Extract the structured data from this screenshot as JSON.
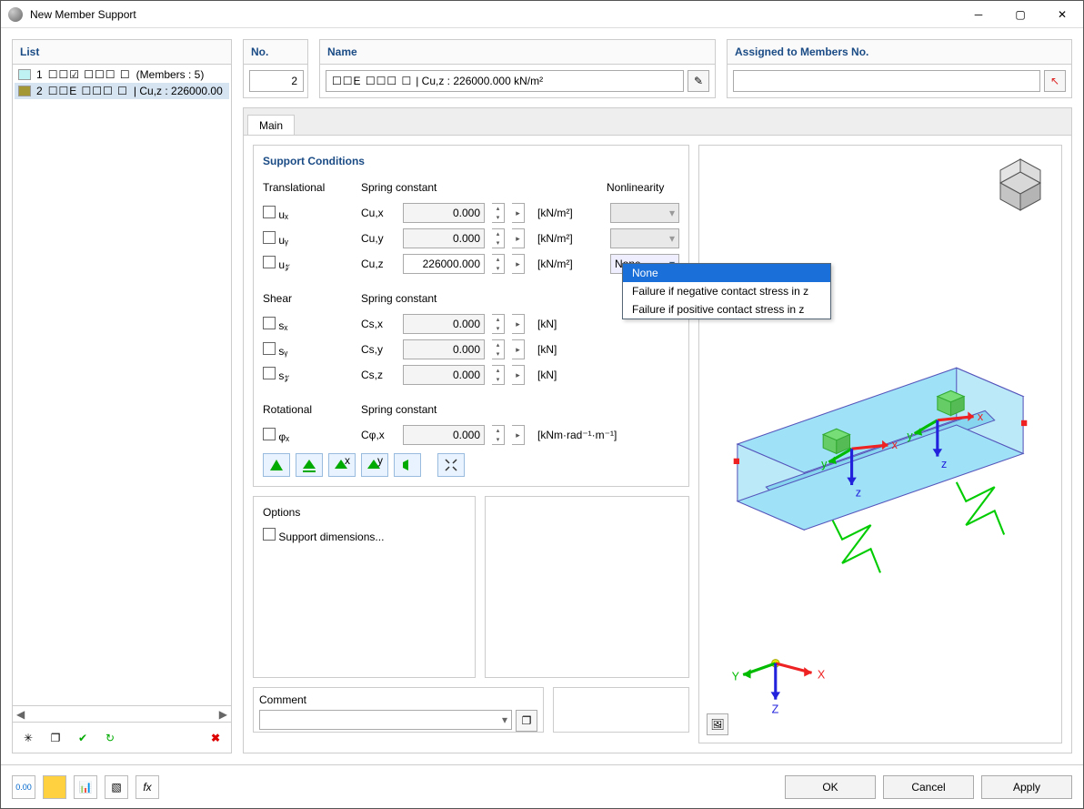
{
  "window": {
    "title": "New Member Support"
  },
  "list": {
    "header": "List",
    "items": [
      {
        "num": "1",
        "swatch": "#bff3f3",
        "glyphs": "☐☐☑ ☐☐☐ ☐",
        "desc": "(Members : 5)"
      },
      {
        "num": "2",
        "swatch": "#a39735",
        "glyphs": "☐☐E  ☐☐☐ ☐",
        "desc": "| Cu,z : 226000.00",
        "selected": true
      }
    ]
  },
  "no": {
    "header": "No.",
    "value": "2"
  },
  "name": {
    "header": "Name",
    "glyphs": "☐☐E  ☐☐☐ ☐",
    "value": "| Cu,z : 226000.000 kN/m²"
  },
  "assign": {
    "header": "Assigned to Members No.",
    "value": ""
  },
  "tab": {
    "main": "Main"
  },
  "support": {
    "title": "Support Conditions",
    "trans_hdr": "Translational",
    "spring_hdr": "Spring constant",
    "nonlin_hdr": "Nonlinearity",
    "rows_trans": [
      {
        "ck_label": "uₓ",
        "spring": "Cu,x",
        "val": "0.000",
        "unit": "[kN/m²]",
        "nl": "",
        "nl_disabled": true
      },
      {
        "ck_label": "uᵧ",
        "spring": "Cu,y",
        "val": "0.000",
        "unit": "[kN/m²]",
        "nl": "",
        "nl_disabled": true
      },
      {
        "ck_label": "u𝓏",
        "spring": "Cu,z",
        "val": "226000.000",
        "unit": "[kN/m²]",
        "nl": "None",
        "nl_disabled": false,
        "active": true
      }
    ],
    "shear_hdr": "Shear",
    "rows_shear": [
      {
        "ck_label": "sₓ",
        "spring": "Cs,x",
        "val": "0.000",
        "unit": "[kN]"
      },
      {
        "ck_label": "sᵧ",
        "spring": "Cs,y",
        "val": "0.000",
        "unit": "[kN]"
      },
      {
        "ck_label": "s𝓏",
        "spring": "Cs,z",
        "val": "0.000",
        "unit": "[kN]"
      }
    ],
    "rot_hdr": "Rotational",
    "rows_rot": [
      {
        "ck_label": "φₓ",
        "spring": "Cφ,x",
        "val": "0.000",
        "unit": "[kNm·rad⁻¹·m⁻¹]"
      }
    ]
  },
  "dropdown": {
    "items": [
      {
        "label": "None",
        "sel": true
      },
      {
        "label": "Failure if negative contact stress in z"
      },
      {
        "label": "Failure if positive contact stress in z"
      }
    ]
  },
  "options": {
    "title": "Options",
    "supp_dim": "Support dimensions..."
  },
  "comment": {
    "title": "Comment",
    "value": ""
  },
  "buttons": {
    "ok": "OK",
    "cancel": "Cancel",
    "apply": "Apply"
  }
}
